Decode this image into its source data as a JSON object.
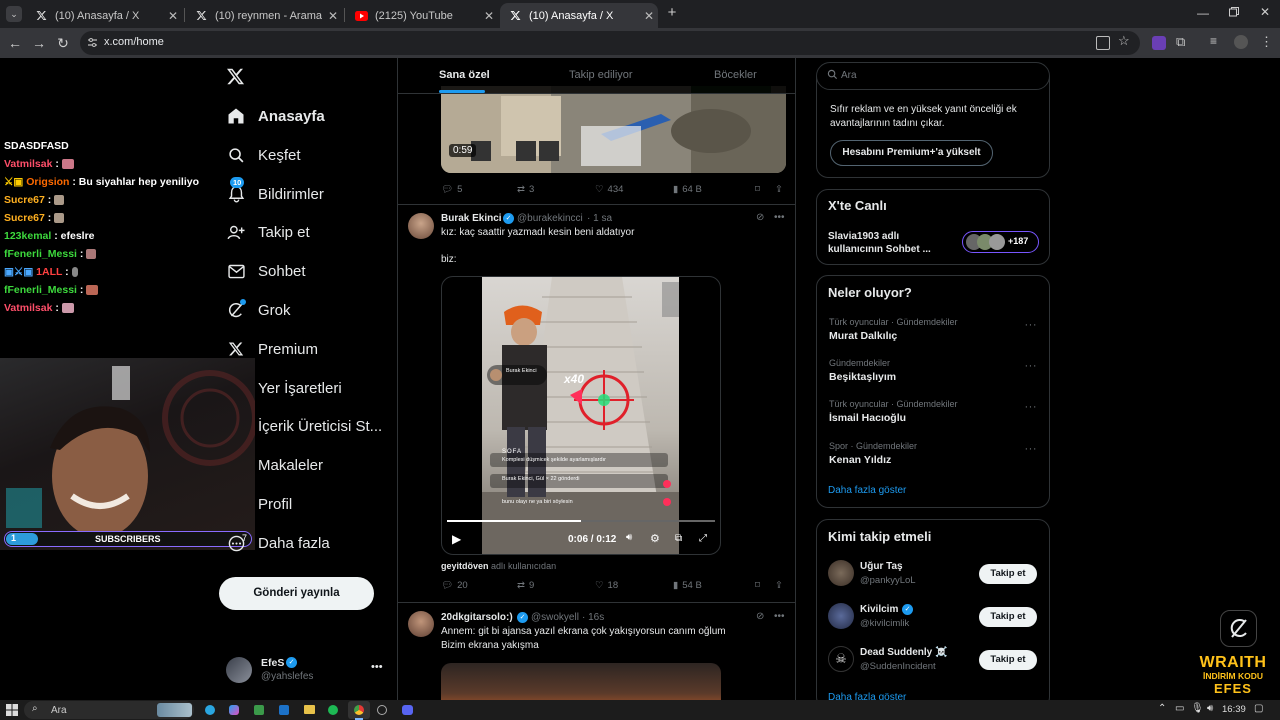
{
  "browser": {
    "tabs": [
      {
        "title": "(10) Anasayfa / X",
        "icon": "x-icon",
        "active": false
      },
      {
        "title": "(10) reynmen - Arama / X",
        "icon": "x-icon",
        "active": false
      },
      {
        "title": "(2125) YouTube",
        "icon": "youtube-icon",
        "active": false
      },
      {
        "title": "(10) Anasayfa / X",
        "icon": "x-icon",
        "active": true
      }
    ],
    "url": "x.com/home"
  },
  "stream": {
    "channel_title": "SDASDFASD",
    "chat": [
      {
        "user": "Vatmilsak",
        "msg": "",
        "color": "#ff4f6a"
      },
      {
        "user": "Origsion",
        "msg": "Bu siyahlar hep yeniliyo",
        "color": "#ff6a00"
      },
      {
        "user": "Sucre67",
        "msg": "",
        "color": "#ffb020"
      },
      {
        "user": "Sucre67",
        "msg": "",
        "color": "#ffb020"
      },
      {
        "user": "123kemal",
        "msg": "efeslre",
        "color": "#3dd93d"
      },
      {
        "user": "fFenerli_Messi",
        "msg": "",
        "color": "#3dd93d"
      },
      {
        "user": "1ALL",
        "msg": "",
        "color": "#ff4040"
      },
      {
        "user": "fFenerli_Messi",
        "msg": "",
        "color": "#3dd93d"
      },
      {
        "user": "Vatmilsak",
        "msg": "",
        "color": "#ff4f6a"
      }
    ],
    "subscribers_label": "SUBSCRIBERS",
    "subscribers_count": "1",
    "sponsor_line1": "WRAITH",
    "sponsor_line2": "İNDİRİM KODU",
    "sponsor_line3": "EFES"
  },
  "sidebar": {
    "items": [
      {
        "label": "Anasayfa",
        "icon": "home-icon"
      },
      {
        "label": "Keşfet",
        "icon": "search-icon"
      },
      {
        "label": "Bildirimler",
        "icon": "bell-icon",
        "badge": "10"
      },
      {
        "label": "Takip et",
        "icon": "follow-icon"
      },
      {
        "label": "Sohbet",
        "icon": "mail-icon"
      },
      {
        "label": "Grok",
        "icon": "grok-icon"
      },
      {
        "label": "Premium",
        "icon": "x-icon"
      },
      {
        "label": "Yer İşaretleri",
        "icon": "bookmark-icon"
      },
      {
        "label": "İçerik Üreticisi St...",
        "icon": "studio-icon"
      },
      {
        "label": "Makaleler",
        "icon": "article-icon"
      },
      {
        "label": "Profil",
        "icon": "profile-icon"
      },
      {
        "label": "Daha fazla",
        "icon": "more-icon"
      }
    ],
    "post_button": "Gönderi yayınla",
    "account": {
      "name": "EfeS",
      "handle": "@yahslefes"
    }
  },
  "feed": {
    "tabs": [
      "Sana özel",
      "Takip ediliyor",
      "Böcekler"
    ],
    "post0": {
      "video_time": "0:59",
      "replies": "5",
      "reposts": "3",
      "likes": "434",
      "views": "64 B"
    },
    "post1": {
      "name": "Burak Ekinci",
      "handle": "@burakekincci",
      "time": "· 1 sa",
      "text1": "kız: kaç saattir yazmadı kesin beni aldatıyor",
      "text2": "biz:",
      "video_time": "0:06 / 0:12",
      "overlay_combo": "x40",
      "overlay_name": "Burak Ekinci",
      "overlay_source": "SOFA",
      "overlay_line": "Komplesi düşmicek şekilde ayarlamışlardır",
      "overlay_gift": "Burak Ekinci, Gül × 22 gönderdi",
      "overlay_chat": "bunu olayı ne ya biri söylesin",
      "credit_user": "geyitdöven",
      "credit_suffix": "adlı kullanıcıdan",
      "replies": "20",
      "reposts": "9",
      "likes": "18",
      "views": "54 B"
    },
    "post2": {
      "name": "20dkgitarsolo:)",
      "handle": "@swokyell",
      "time": "· 16s",
      "text1": "Annem: git bi ajansa yazıl ekrana çok yakışıyorsun canım oğlum",
      "text2": "Bizim ekrana yakışma"
    }
  },
  "right": {
    "search_placeholder": "Ara",
    "premium_title": "Hesabını Premium+'a yükselt",
    "premium_desc": "Sıfır reklam ve en yüksek yanıt önceliği ek avantajlarının tadını çıkar.",
    "premium_button": "Hesabını Premium+'a yükselt",
    "live_title": "X'te Canlı",
    "live_line1": "Slavia1903 adlı",
    "live_line2": "kullanıcının Sohbet ...",
    "live_count": "+187",
    "trends_title": "Neler oluyor?",
    "trends": [
      {
        "meta": "Türk oyuncular · Gündemdekiler",
        "name": "Murat Dalkılıç"
      },
      {
        "meta": "Gündemdekiler",
        "name": "Beşiktaşlıyım"
      },
      {
        "meta": "Türk oyuncular · Gündemdekiler",
        "name": "İsmail Hacıoğlu"
      },
      {
        "meta": "Spor · Gündemdekiler",
        "name": "Kenan Yıldız"
      }
    ],
    "show_more": "Daha fazla göster",
    "follow_title": "Kimi takip etmeli",
    "follow": [
      {
        "name": "Uğur Taş",
        "handle": "@pankyyLoL",
        "verified": false
      },
      {
        "name": "Kivilcim",
        "handle": "@kivilcimlik",
        "verified": true
      },
      {
        "name": "Dead Suddenly ☠️",
        "handle": "@SuddenIncident",
        "verified": false
      }
    ],
    "follow_button": "Takip et",
    "show_more2": "Daha fazla göster"
  },
  "taskbar": {
    "search": "Ara",
    "time": "16:39"
  },
  "colors": {
    "accent": "#1d9bf0",
    "background": "#000000",
    "border": "#2f3336",
    "muted": "#71767b"
  }
}
